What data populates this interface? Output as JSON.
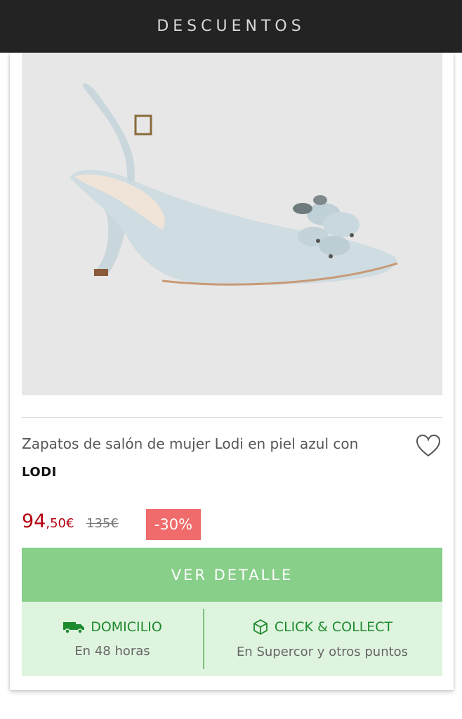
{
  "header": {
    "title": "DESCUENTOS"
  },
  "product": {
    "title": "Zapatos de salón de mujer Lodi en piel azul con",
    "brand": "LODI",
    "price_integer": "94",
    "price_decimal": ",50€",
    "old_price": "135€",
    "discount": "-30%",
    "image_icon": "shoe-image"
  },
  "actions": {
    "detail_label": "VER DETALLE"
  },
  "delivery": {
    "home": {
      "label": "DOMICILIO",
      "sub": "En 48 horas",
      "icon": "truck-icon"
    },
    "collect": {
      "label": "CLICK & COLLECT",
      "sub": "En Supercor y otros puntos",
      "icon": "box-icon"
    }
  },
  "colors": {
    "header_bg": "#232323",
    "price": "#b5000f",
    "badge": "#f06b6b",
    "cta": "#88cf8a",
    "delivery_bg": "#dff4df",
    "delivery_text": "#1e8a2e"
  }
}
